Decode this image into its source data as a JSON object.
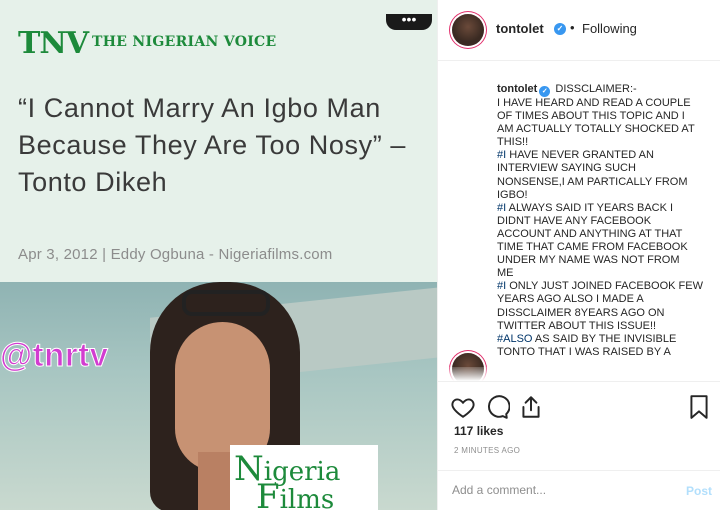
{
  "media": {
    "brand_logo": "TNV",
    "brand_sub": "THE NIGERIAN VOICE",
    "more_options": "•••",
    "headline": "“I Cannot Marry An Igbo Man Because They Are Too Nosy” – Tonto Dikeh",
    "byline": "Apr 3, 2012 | Eddy Ogbuna - Nigeriafilms.com",
    "watermark_handle": "@tnrtv",
    "nf_logo_line1_initial": "N",
    "nf_logo_line1_rest": "igeria",
    "nf_logo_line2_initial": "F",
    "nf_logo_line2_rest": "ilms"
  },
  "header": {
    "username": "tontolet",
    "verified_mark": "✓",
    "separator": "•",
    "follow_status": "Following"
  },
  "caption": {
    "username": "tontolet",
    "lines": [
      "DISSCLAIMER:-",
      "I HAVE HEARD AND READ A COUPLE",
      "OF TIMES ABOUT THIS TOPIC AND I",
      "AM ACTUALLY TOTALLY SHOCKED AT",
      "THIS!!",
      "#I HAVE NEVER GRANTED AN",
      "INTERVIEW SAYING SUCH",
      "NONSENSE,I AM PARTICALLY FROM",
      "IGBO!",
      "#I ALWAYS SAID IT YEARS BACK I",
      "DIDNT HAVE ANY FACEBOOK",
      "ACCOUNT AND ANYTHING AT THAT",
      "TIME THAT CAME FROM FACEBOOK",
      "UNDER MY NAME WAS NOT FROM",
      "ME",
      "#I ONLY JUST JOINED FACEBOOK FEW",
      "YEARS AGO ALSO I MADE A",
      "DISSCLAIMER 8YEARS AGO ON",
      "TWITTER ABOUT THIS ISSUE!!",
      "#ALSO AS SAID BY THE INVISIBLE",
      "TONTO THAT I WAS RAISED BY A"
    ]
  },
  "engagement": {
    "likes": "117 likes",
    "timestamp": "2 MINUTES AGO"
  },
  "comment": {
    "placeholder": "Add a comment...",
    "post_label": "Post"
  },
  "icons": [
    "heart-icon",
    "comment-icon",
    "share-icon",
    "bookmark-icon",
    "verified-icon"
  ],
  "colors": {
    "brand_green": "#1d8a3b",
    "handle_magenta": "#d23dd0",
    "verified_blue": "#3897f0",
    "hashtag_blue": "#003569",
    "post_disabled": "#b2dffc"
  }
}
